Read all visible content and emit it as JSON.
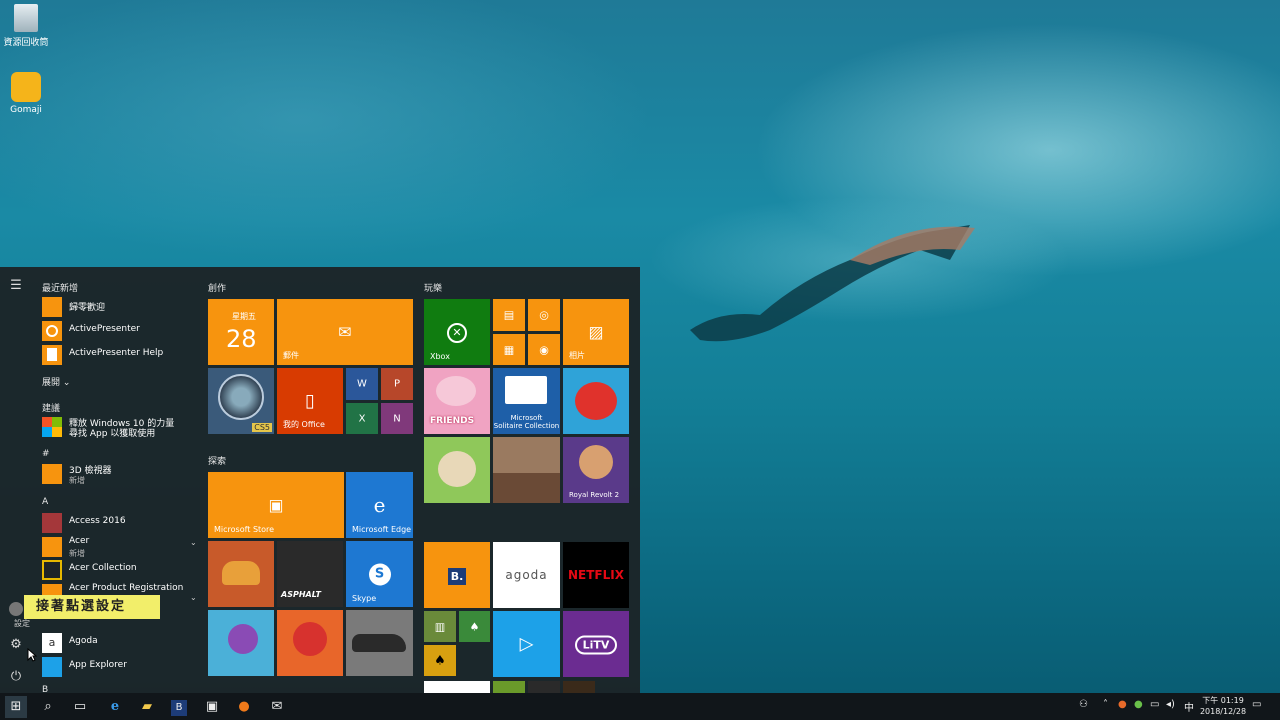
{
  "desktop": {
    "icons": [
      {
        "label": "資源回收筒",
        "icon": "recycle-bin-icon"
      },
      {
        "label": "Gomaji",
        "icon": "gomaji-app-icon"
      }
    ]
  },
  "start_menu": {
    "recent_header": "最近新增",
    "recent": [
      {
        "label": "歸零歡迎",
        "icon": "app-icon"
      },
      {
        "label": "ActivePresenter",
        "icon": "activepresenter-icon"
      },
      {
        "label": "ActivePresenter Help",
        "icon": "help-doc-icon"
      }
    ],
    "expand_label": "展開",
    "suggest_header": "建議",
    "suggest": {
      "line1": "釋放 Windows 10 的力量",
      "line2": "尋找 App 以獲取使用"
    },
    "hash_header": "#",
    "viewer3d": {
      "label": "3D 檢視器",
      "sub": "新增"
    },
    "a_header": "A",
    "apps": [
      {
        "label": "Access 2016"
      },
      {
        "label": "Acer",
        "sub": "新增"
      },
      {
        "label": "Acer Collection"
      },
      {
        "label": "Acer Product Registration",
        "sub": "新增"
      },
      {
        "label": "Agoda"
      },
      {
        "label": "App Explorer"
      }
    ],
    "b_header": "B",
    "settings_tip": "設定",
    "overlay_text": "接著點選設定",
    "groups": {
      "create": "創作",
      "play": "玩樂",
      "explore": "探索"
    },
    "tiles": {
      "calendar_day": "星期五",
      "calendar_date": "28",
      "mail": "郵件",
      "my_office": "我的 Office",
      "xbox": "Xbox",
      "photos": "相片",
      "solitaire_line1": "Microsoft",
      "solitaire_line2": "Solitaire Collection",
      "store": "Microsoft Store",
      "edge": "Microsoft Edge",
      "skype": "Skype",
      "booking": "B.",
      "agoda": "agoda",
      "netflix": "NETFLIX",
      "litv": "LiTV",
      "friends": "FRIENDS",
      "asphalt": "ASPHALT",
      "royal": "Royal Revolt 2",
      "cs5": "CS5"
    }
  },
  "taskbar": {
    "clock_time": "下午 01:19",
    "clock_date": "2018/12/28",
    "ime": "中"
  },
  "colors": {
    "accent_orange": "#f7940e",
    "start_bg": "#1c2428",
    "taskbar_bg": "#11161a",
    "xbox_green": "#107c10",
    "edge_blue": "#1e78d2",
    "netflix_red": "#e50914",
    "litv_purple": "#6b2c91"
  }
}
